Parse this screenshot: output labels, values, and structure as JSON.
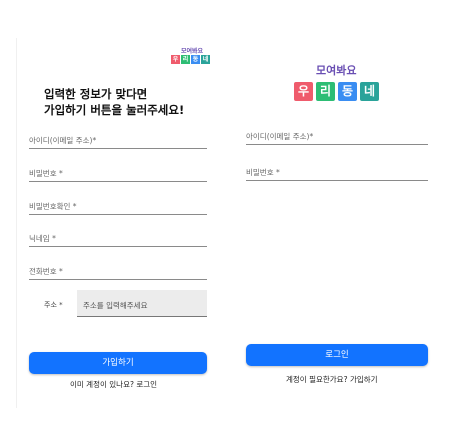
{
  "brand": {
    "slogan": "모여봐요",
    "tiles": [
      "우",
      "리",
      "동",
      "네"
    ],
    "tile_colors": [
      "#ef5b6c",
      "#2dbd74",
      "#3a8df2",
      "#2aa39a"
    ]
  },
  "signup": {
    "headline_line1": "입력한 정보가 맞다면",
    "headline_line2": "가입하기 버튼을 눌러주세요!",
    "fields": [
      {
        "label": "아이디(이메일 주소)"
      },
      {
        "label": "비밀번호"
      },
      {
        "label": "비밀번호확인"
      },
      {
        "label": "닉네임"
      },
      {
        "label": "전화번호"
      }
    ],
    "address_label": "주소",
    "address_placeholder": "주소를 입력해주세요",
    "submit_label": "가입하기",
    "login_link": "이미 계정이 있나요? 로그인"
  },
  "login": {
    "fields": [
      {
        "label": "아이디(이메일 주소)"
      },
      {
        "label": "비밀번호"
      }
    ],
    "submit_label": "로그인",
    "signup_link": "계정이 필요한가요? 가입하기"
  },
  "colors": {
    "primary": "#1273ff"
  }
}
